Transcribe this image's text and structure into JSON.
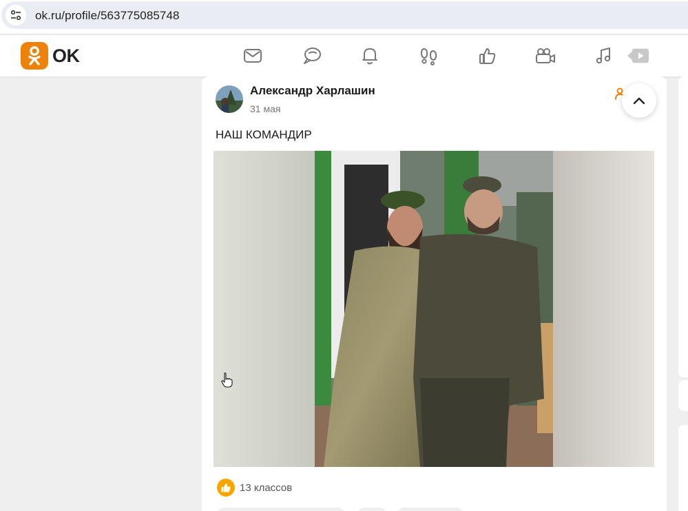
{
  "browser": {
    "url": "ok.ru/profile/563775085748",
    "site_info_icon": "tune-icon"
  },
  "header": {
    "logo_text": "OK",
    "brand_color": "#ee8208",
    "nav_icons": [
      "mail-icon",
      "chat-icon",
      "bell-icon",
      "footprints-icon",
      "thumbs-up-icon",
      "video-camera-icon",
      "music-icon",
      "play-video-icon"
    ]
  },
  "post": {
    "author": "Александр Харлашин",
    "date": "31 мая",
    "text": "НАШ КОМАНДИР",
    "likes_text": "13 классов",
    "likes_color": "#f7a600"
  }
}
